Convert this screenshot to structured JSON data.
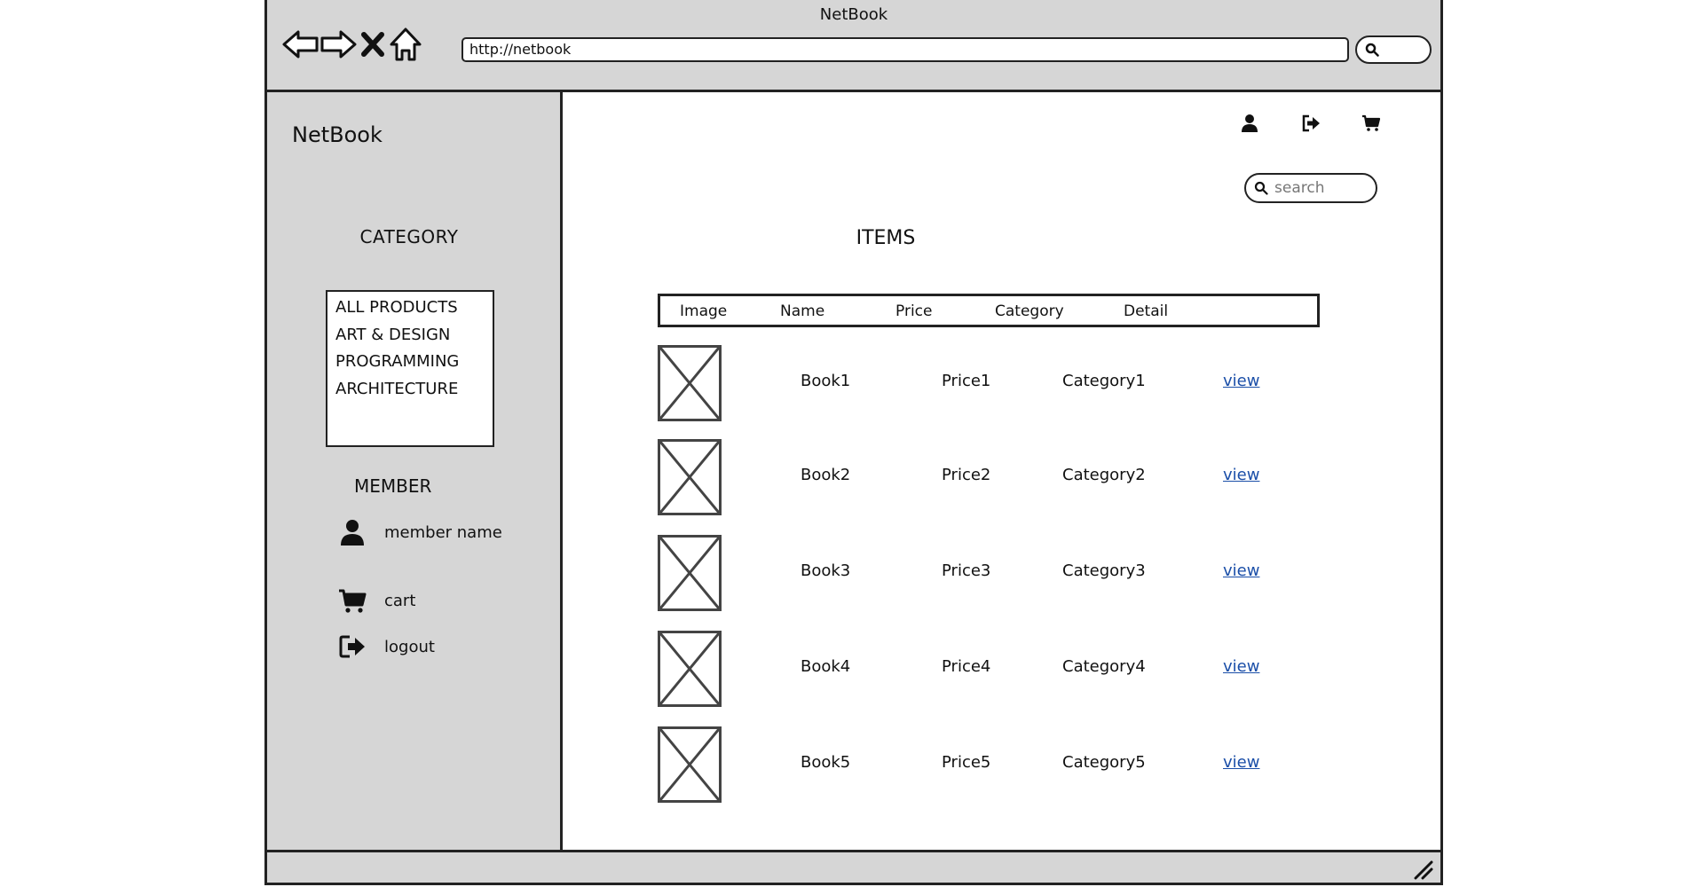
{
  "window": {
    "title": "NetBook",
    "url": "http://netbook",
    "nav": [
      "back-icon",
      "forward-icon",
      "stop-icon",
      "home-icon"
    ]
  },
  "sidebar": {
    "brand": "NetBook",
    "category_title": "CATEGORY",
    "categories": [
      "ALL PRODUCTS",
      "ART & DESIGN",
      "PROGRAMMING",
      "ARCHITECTURE"
    ],
    "member_title": "MEMBER",
    "member_name": "member name",
    "cart_label": "cart",
    "logout_label": "logout"
  },
  "header": {
    "icons": [
      "user-icon",
      "logout-icon",
      "cart-icon"
    ],
    "search_placeholder": "search"
  },
  "main": {
    "title": "ITEMS",
    "columns": [
      "Image",
      "Name",
      "Price",
      "Category",
      "Detail"
    ],
    "rows": [
      {
        "name": "Book1",
        "price": "Price1",
        "category": "Category1",
        "detail": "view"
      },
      {
        "name": "Book2",
        "price": "Price2",
        "category": "Category2",
        "detail": "view"
      },
      {
        "name": "Book3",
        "price": "Price3",
        "category": "Category3",
        "detail": "view"
      },
      {
        "name": "Book4",
        "price": "Price4",
        "category": "Category4",
        "detail": "view"
      },
      {
        "name": "Book5",
        "price": "Price5",
        "category": "Category5",
        "detail": "view"
      }
    ]
  },
  "colors": {
    "chrome_gray": "#d6d6d6",
    "link_blue": "#1a4ea8",
    "border_dark": "#222222"
  }
}
